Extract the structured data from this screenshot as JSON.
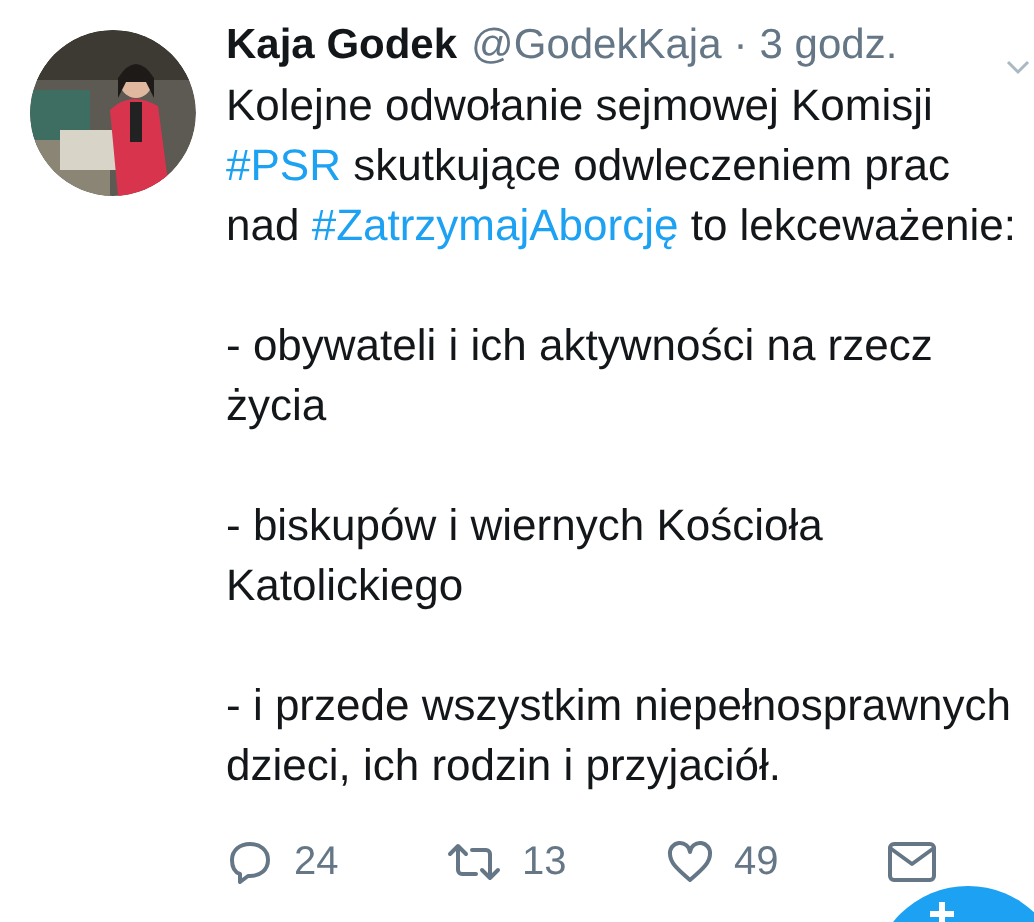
{
  "tweet": {
    "author_name": "Kaja Godek",
    "handle": "@GodekKaja",
    "separator": "·",
    "time": "3 godz.",
    "paragraphs": [
      {
        "segments": [
          {
            "kind": "text",
            "text": "Kolejne odwołanie sejmowej Komisji "
          },
          {
            "kind": "hashtag",
            "text": "#PSR"
          },
          {
            "kind": "text",
            "text": " skutkujące odwleczeniem prac nad "
          },
          {
            "kind": "hashtag",
            "text": "#ZatrzymajAborcję"
          },
          {
            "kind": "text",
            "text": " to lekceważenie:"
          }
        ]
      },
      {
        "segments": [
          {
            "kind": "text",
            "text": "- obywateli i ich aktywności na rzecz życia"
          }
        ]
      },
      {
        "segments": [
          {
            "kind": "text",
            "text": "- biskupów i wiernych Kościoła Katolickiego"
          }
        ]
      },
      {
        "segments": [
          {
            "kind": "text",
            "text": "- i przede wszystkim niepełnosprawnych dzieci, ich rodzin i przyjaciół."
          }
        ]
      }
    ],
    "actions": [
      {
        "kind": "reply",
        "count": "24"
      },
      {
        "kind": "retweet",
        "count": "13"
      },
      {
        "kind": "like",
        "count": "49"
      },
      {
        "kind": "message"
      }
    ]
  }
}
